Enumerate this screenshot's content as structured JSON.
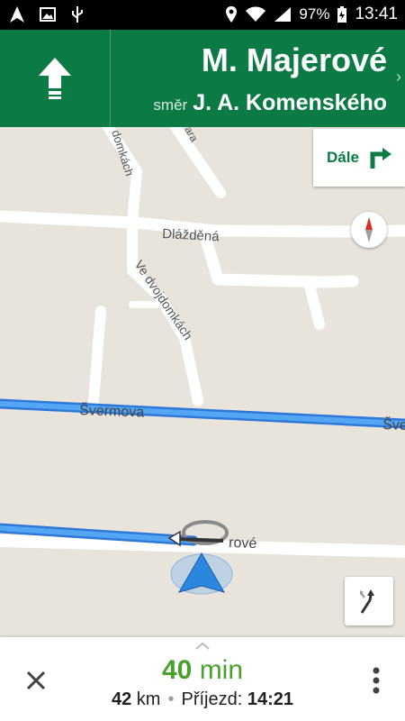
{
  "status_bar": {
    "battery": "97%",
    "time": "13:41"
  },
  "header": {
    "street": "M. Majerové",
    "direction_prefix": "směr",
    "direction_street": "J. A. Komenského",
    "maneuver_icon": "straight-arrow-icon"
  },
  "then_card": {
    "label": "Dále",
    "icon": "turn-right-arrow-icon"
  },
  "map": {
    "labels": {
      "road1": "domkách",
      "road2": "ara",
      "road3": "Dlážděná",
      "road4": "Ve dvojdomkách",
      "road5": "Švermova",
      "road6": "Šve",
      "road7": "rové"
    },
    "route_color": "#3b8eea"
  },
  "bottom": {
    "minutes": "40",
    "minutes_unit": "min",
    "distance": "42",
    "distance_unit": "km",
    "arrival_label": "Příjezd:",
    "arrival_time": "14:21"
  }
}
